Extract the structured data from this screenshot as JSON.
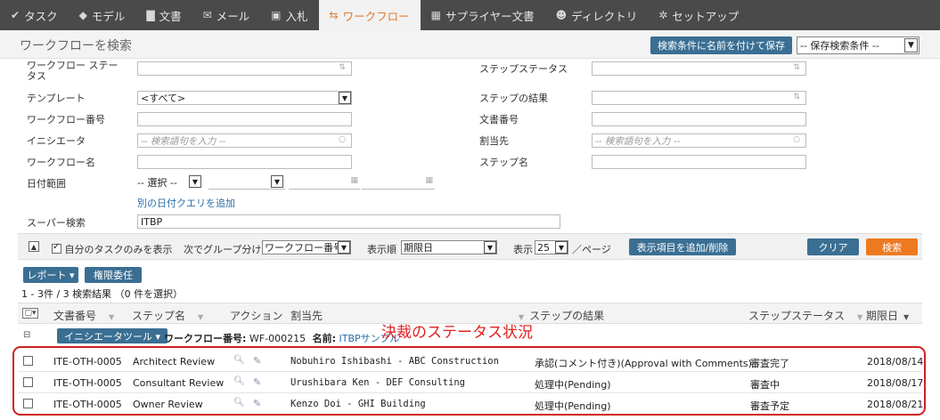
{
  "nav": {
    "items": [
      {
        "label": "タスク",
        "icon": "check-icon",
        "glyph": "✔"
      },
      {
        "label": "モデル",
        "icon": "cube-icon",
        "glyph": "◆"
      },
      {
        "label": "文書",
        "icon": "document-icon",
        "glyph": "▇"
      },
      {
        "label": "メール",
        "icon": "mail-icon",
        "glyph": "✉"
      },
      {
        "label": "入札",
        "icon": "bid-icon",
        "glyph": "▣"
      },
      {
        "label": "ワークフロー",
        "icon": "workflow-icon",
        "glyph": "⇆",
        "active": true
      },
      {
        "label": "サプライヤー文書",
        "icon": "supplier-doc-icon",
        "glyph": "▦"
      },
      {
        "label": "ディレクトリ",
        "icon": "users-icon",
        "glyph": "☻"
      },
      {
        "label": "セットアップ",
        "icon": "gear-icon",
        "glyph": "✲"
      }
    ]
  },
  "header": {
    "title": "ワークフローを検索",
    "save_search_label": "検索条件に名前を付けて保存",
    "saved_search_value": "-- 保存検索条件 --"
  },
  "form": {
    "workflow_status_label": "ワークフロー ステータス",
    "step_status_label": "ステップステータス",
    "template_label": "テンプレート",
    "template_value": "<すべて>",
    "step_result_label": "ステップの結果",
    "workflow_number_label": "ワークフロー番号",
    "doc_number_label": "文書番号",
    "initiator_label": "イニシエータ",
    "initiator_placeholder": "-- 検索語句を入力 --",
    "assignee_label": "割当先",
    "assignee_placeholder": "-- 検索語句を入力 --",
    "workflow_name_label": "ワークフロー名",
    "step_name_label": "ステップ名",
    "date_range_label": "日付範囲",
    "date_select_value": "-- 選択 --",
    "add_date_query_link": "別の日付クエリを追加",
    "super_search_label": "スーパー検索",
    "super_search_value": "ITBP"
  },
  "options": {
    "only_my_tasks_label": "自分のタスクのみを表示",
    "group_by_label": "次でグループ分け",
    "group_by_value": "ワークフロー番号",
    "sort_label": "表示順",
    "sort_value": "期限日",
    "show_label": "表示",
    "show_value": "25",
    "per_page_label": "／ページ",
    "columns_button": "表示項目を追加/削除",
    "clear_button": "クリア",
    "search_button": "検索"
  },
  "results": {
    "report_button": "レポート ▾",
    "delegate_button": "権限委任",
    "count_text": "1 - 3件 / 3 検索結果 （0 件を選択）",
    "columns": {
      "doc_number": "文書番号",
      "step_name": "ステップ名",
      "action": "アクション",
      "assignee": "割当先",
      "step_result": "ステップの結果",
      "step_status": "ステップステータス",
      "due_date": "期限日"
    },
    "group": {
      "tool_button": "イニシエータツール ▾",
      "number_label": "ワークフロー番号:",
      "number_value": "WF-000215",
      "name_label": "名前:",
      "name_value": "ITBPサンプル"
    },
    "rows": [
      {
        "doc": "ITE-OTH-0005",
        "step": "Architect Review",
        "assignee": "Nobuhiro Ishibashi - ABC Construction",
        "result": "承認(コメント付き)(Approval with Comments)",
        "status": "審査完了",
        "due": "2018/08/14"
      },
      {
        "doc": "ITE-OTH-0005",
        "step": "Consultant Review",
        "assignee": "Urushibara Ken - DEF Consulting",
        "result": "処理中(Pending)",
        "status": "審査中",
        "due": "2018/08/17"
      },
      {
        "doc": "ITE-OTH-0005",
        "step": "Owner Review",
        "assignee": "Kenzo Doi - GHI Building",
        "result": "処理中(Pending)",
        "status": "審査予定",
        "due": "2018/08/21"
      }
    ]
  },
  "annotation": {
    "text": "決裁のステータス状況",
    "color": "#e02020"
  },
  "colors": {
    "nav_bg": "#4a4a4a",
    "accent_orange": "#ee7a20",
    "button_blue": "#3a6f93",
    "link_blue": "#2b6ea8"
  }
}
